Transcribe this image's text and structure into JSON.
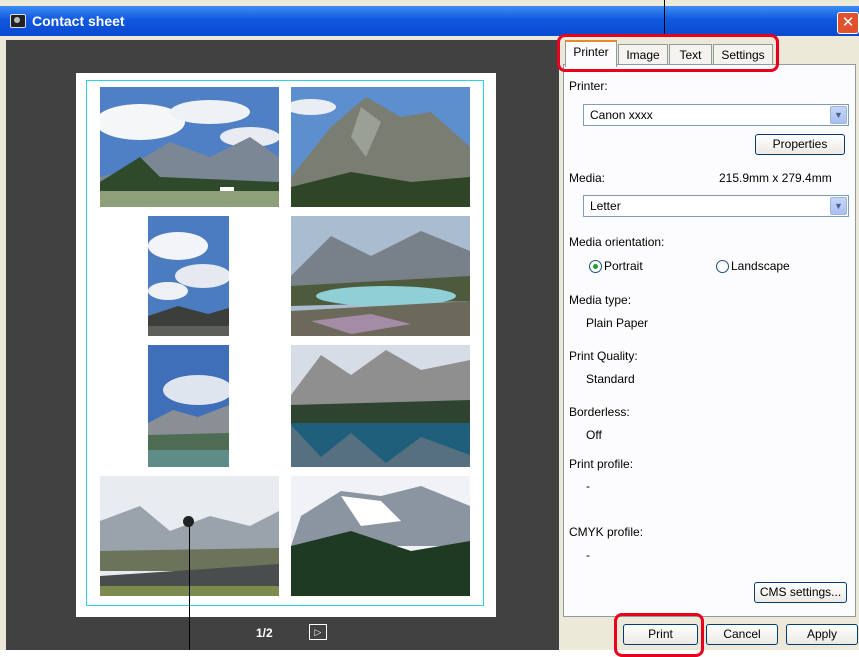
{
  "window": {
    "title": "Contact sheet",
    "close_glyph": "✕"
  },
  "tabs": [
    "Printer",
    "Image",
    "Text",
    "Settings"
  ],
  "printer": {
    "printer_label": "Printer:",
    "printer_value": "Canon xxxx",
    "properties_button": "Properties",
    "media_label": "Media:",
    "media_size": "215.9mm x 279.4mm",
    "media_value": "Letter",
    "orientation_label": "Media orientation:",
    "portrait": "Portrait",
    "landscape": "Landscape",
    "orientation_selected": "Portrait",
    "media_type_label": "Media type:",
    "media_type_value": "Plain Paper",
    "quality_label": "Print Quality:",
    "quality_value": "Standard",
    "borderless_label": "Borderless:",
    "borderless_value": "Off",
    "print_profile_label": "Print profile:",
    "print_profile_value": "-",
    "cmyk_profile_label": "CMYK profile:",
    "cmyk_profile_value": "-",
    "cms_button": "CMS settings..."
  },
  "preview": {
    "page_indicator": "1/2",
    "next_glyph": "▷"
  },
  "footer": {
    "print": "Print",
    "cancel": "Cancel",
    "apply": "Apply"
  },
  "icons": {
    "combo_arrow": "chevron-down-icon",
    "app": "camera-icon"
  },
  "colors": {
    "title_bar": "#1058e0",
    "callout": "#e8001c",
    "printable_border": "#2ad4e0",
    "preview_bg": "#414141"
  }
}
